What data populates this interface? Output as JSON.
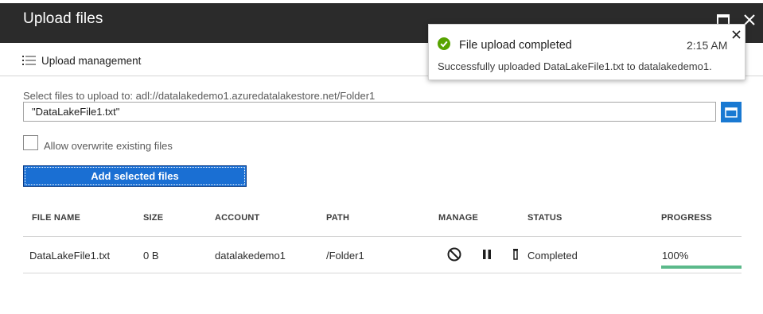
{
  "window": {
    "title": "Upload files",
    "maximize_icon": "maximize-icon",
    "close_icon": "close-icon"
  },
  "toolbar": {
    "upload_management_label": "Upload management",
    "icon": "list-icon"
  },
  "form": {
    "select_label": "Select files to upload to: adl://datalakedemo1.azuredatalakestore.net/Folder1",
    "file_value": "\"DataLakeFile1.txt\"",
    "browse_icon": "folder-icon",
    "overwrite_label": "Allow overwrite existing files",
    "overwrite_checked": false,
    "add_button_label": "Add selected files"
  },
  "table": {
    "headers": [
      "FILE NAME",
      "SIZE",
      "ACCOUNT",
      "PATH",
      "MANAGE",
      "STATUS",
      "PROGRESS"
    ],
    "rows": [
      {
        "file_name": "DataLakeFile1.txt",
        "size": "0 B",
        "account": "datalakedemo1",
        "path": "/Folder1",
        "manage_icons": [
          "cancel-icon",
          "pause-icon",
          "delete-icon"
        ],
        "status": "Completed",
        "progress_text": "100%",
        "progress_fraction": 1.0
      }
    ]
  },
  "notification": {
    "title": "File upload completed",
    "time": "2:15 AM",
    "message": "Successfully uploaded DataLakeFile1.txt to datalakedemo1.",
    "icon": "success-check-icon",
    "close_icon": "close-icon"
  },
  "colors": {
    "titlebar": "#2b2b2b",
    "accent": "#1a6fd3",
    "success": "#5bb98a",
    "check": "#57a300"
  }
}
